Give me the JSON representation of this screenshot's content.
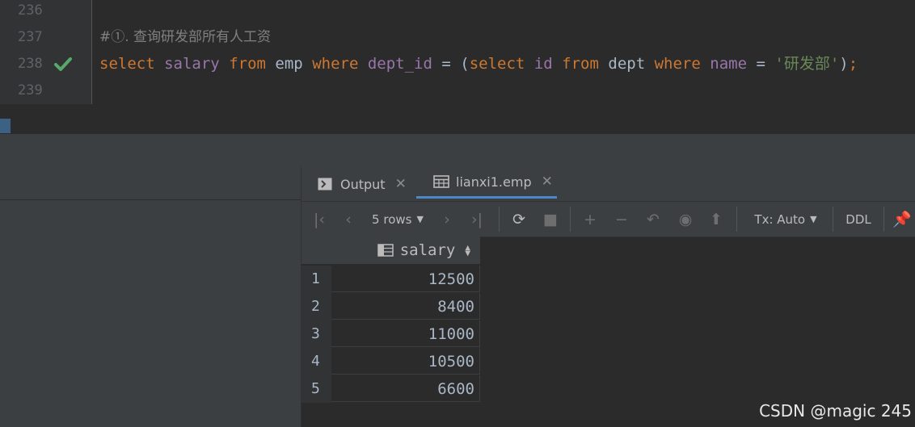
{
  "editor": {
    "lines": [
      {
        "num": "236",
        "status": ""
      },
      {
        "num": "237",
        "comment": "#①. 查询研发部所有人工资"
      },
      {
        "num": "238",
        "status": "success",
        "code": {
          "t1": "select",
          "t2": "salary",
          "t3": "from",
          "t4": "emp",
          "t5": "where",
          "t6": "dept_id",
          "t7": "=",
          "t8": "(",
          "t9": "select",
          "t10": "id",
          "t11": "from",
          "t12": "dept",
          "t13": "where",
          "t14": "name",
          "t15": "=",
          "t16": "'研发部'",
          "t17": ")",
          "t18": ";"
        }
      },
      {
        "num": "239",
        "status": ""
      }
    ]
  },
  "results": {
    "tabs": [
      {
        "label": "Output",
        "icon": "console-icon"
      },
      {
        "label": "lianxi1.emp",
        "icon": "table-icon"
      }
    ],
    "toolbar": {
      "rows_label": "5 rows",
      "tx_label": "Tx: Auto",
      "ddl_label": "DDL"
    },
    "column": "salary",
    "rows": [
      {
        "n": "1",
        "v": "12500"
      },
      {
        "n": "2",
        "v": "8400"
      },
      {
        "n": "3",
        "v": "11000"
      },
      {
        "n": "4",
        "v": "10500"
      },
      {
        "n": "5",
        "v": "6600"
      }
    ]
  },
  "watermark": "CSDN @magic 245",
  "colors": {
    "keyword": "#cc7832",
    "column": "#9876aa",
    "string": "#6a8759",
    "success": "#59a869"
  }
}
